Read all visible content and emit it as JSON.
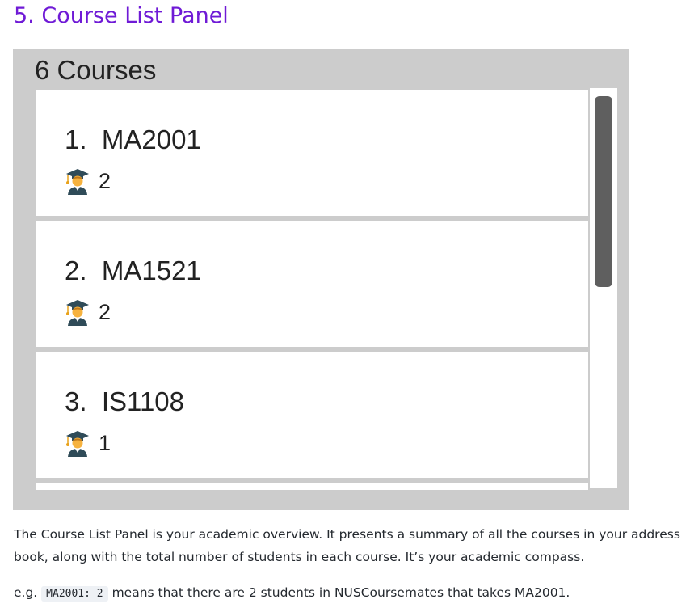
{
  "heading": "5. Course List Panel",
  "panel": {
    "title": "6 Courses",
    "courses": [
      {
        "name": "1.  MA2001",
        "students": "2"
      },
      {
        "name": "2.  MA1521",
        "students": "2"
      },
      {
        "name": "3.  IS1108",
        "students": "1"
      }
    ],
    "student_icon": "graduate-student-icon"
  },
  "description": "The Course List Panel is your academic overview. It presents a summary of all the courses in your address book, along with the total number of students in each course. It’s your academic compass.",
  "example": {
    "prefix": "e.g.",
    "code": "MA2001: 2",
    "suffix": "means that there are 2 students in NUSCoursemates that takes MA2001."
  }
}
